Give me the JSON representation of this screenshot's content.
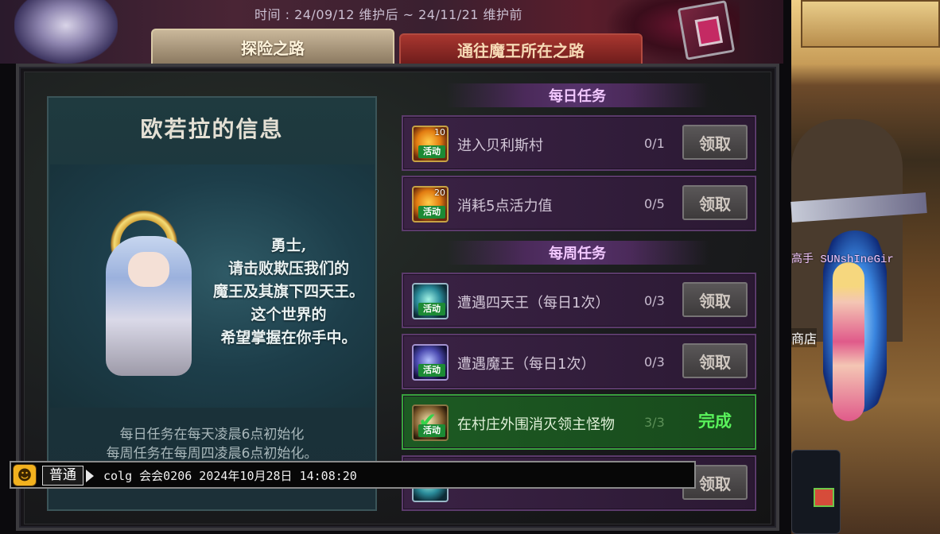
{
  "event": {
    "period": "时间 : 24/09/12 维护后 ~ 24/11/21 维护前"
  },
  "tabs": [
    {
      "label": "探险之路"
    },
    {
      "label": "通往魔王所在之路"
    }
  ],
  "npc": {
    "title": "欧若拉的信息",
    "speech": [
      "勇士,",
      "请击败欺压我们的",
      "魔王及其旗下四天王。",
      "这个世界的",
      "希望掌握在你手中。"
    ],
    "reset_notes": [
      "每日任务在每天凌晨6点初始化",
      "每周任务在每周四凌晨6点初始化。"
    ]
  },
  "daily": {
    "header": "每日任务",
    "quests": [
      {
        "icon_num": "10",
        "icon_tag": "活动",
        "name": "进入贝利斯村",
        "progress": "0/1",
        "button": "领取"
      },
      {
        "icon_num": "20",
        "icon_tag": "活动",
        "name": "消耗5点活力值",
        "progress": "0/5",
        "button": "领取"
      }
    ]
  },
  "weekly": {
    "header": "每周任务",
    "quests": [
      {
        "icon_tag": "活动",
        "name": "遭遇四天王（每日1次）",
        "progress": "0/3",
        "button": "领取"
      },
      {
        "icon_tag": "活动",
        "name": "遭遇魔王（每日1次）",
        "progress": "0/3",
        "button": "领取"
      },
      {
        "icon_tag": "活动",
        "name": "在村庄外围消灭领主怪物",
        "progress": "3/3",
        "status": "完成"
      },
      {
        "button": "领取"
      }
    ]
  },
  "chat": {
    "channel": "普通",
    "input_text": "colg 会会0206 2024年10月28日 14:08:20"
  },
  "world": {
    "player_name": "高手 SUNshIneGir",
    "shop_label": "商店"
  },
  "icons": {
    "chat_emoji": "frog-emoji-icon",
    "complete_check": "checkmark-icon"
  },
  "colors": {
    "daily_header": "#f2c8ff",
    "complete_green": "#59f25b",
    "quest_row": "#3a2244"
  }
}
